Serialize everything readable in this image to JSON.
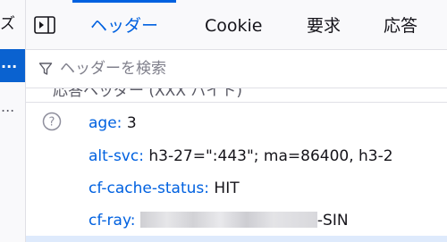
{
  "left_panel": {
    "tail_text": "ズ",
    "selected_row_text": "...",
    "row2_text": "...",
    "selection_color": "#0a62d0"
  },
  "tabs": {
    "items": [
      {
        "label": "ヘッダー",
        "active": true
      },
      {
        "label": "Cookie",
        "active": false
      },
      {
        "label": "要求",
        "active": false
      },
      {
        "label": "応答",
        "active": false
      }
    ],
    "accent_color": "#0061e0"
  },
  "filter": {
    "icon": "filter-icon",
    "placeholder": "ヘッダーを検索",
    "value": ""
  },
  "headers": {
    "section_title_partial": "応答ヘッダー (XXX バイト)",
    "help_icon": "question-circle-icon",
    "rows": [
      {
        "name": "age",
        "value": "3"
      },
      {
        "name": "alt-svc",
        "value": "h3-27=\":443\"; ma=86400, h3-2"
      },
      {
        "name": "cf-cache-status",
        "value": "HIT"
      },
      {
        "name": "cf-ray",
        "value": "-SIN",
        "redacted": true
      }
    ]
  }
}
